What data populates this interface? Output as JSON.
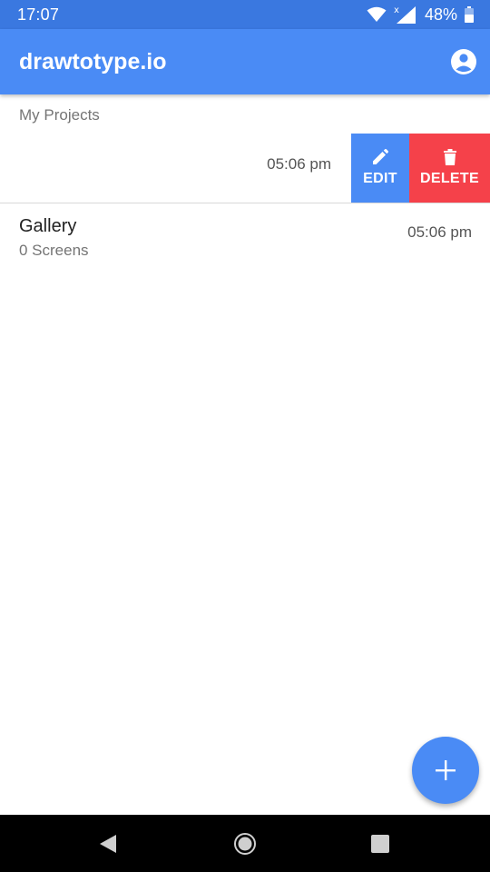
{
  "status_bar": {
    "time": "17:07",
    "battery": "48%",
    "icons": [
      "wifi-icon",
      "signal-icon",
      "battery-icon"
    ]
  },
  "app_bar": {
    "title": "drawtotype.io",
    "account_icon": "account-circle-icon"
  },
  "section": {
    "label": "My Projects"
  },
  "swiped_row": {
    "time": "05:06 pm",
    "edit_label": "EDIT",
    "delete_label": "DELETE"
  },
  "projects": [
    {
      "name": "Gallery",
      "screens": "0 Screens",
      "time": "05:06 pm"
    }
  ],
  "fab": {
    "icon": "plus-icon"
  },
  "nav": {
    "icons": [
      "back-icon",
      "home-icon",
      "recents-icon"
    ]
  },
  "colors": {
    "status_bar": "#3a78e0",
    "primary": "#4a8bf5",
    "delete": "#f5414a",
    "nav_bar": "#000000"
  }
}
